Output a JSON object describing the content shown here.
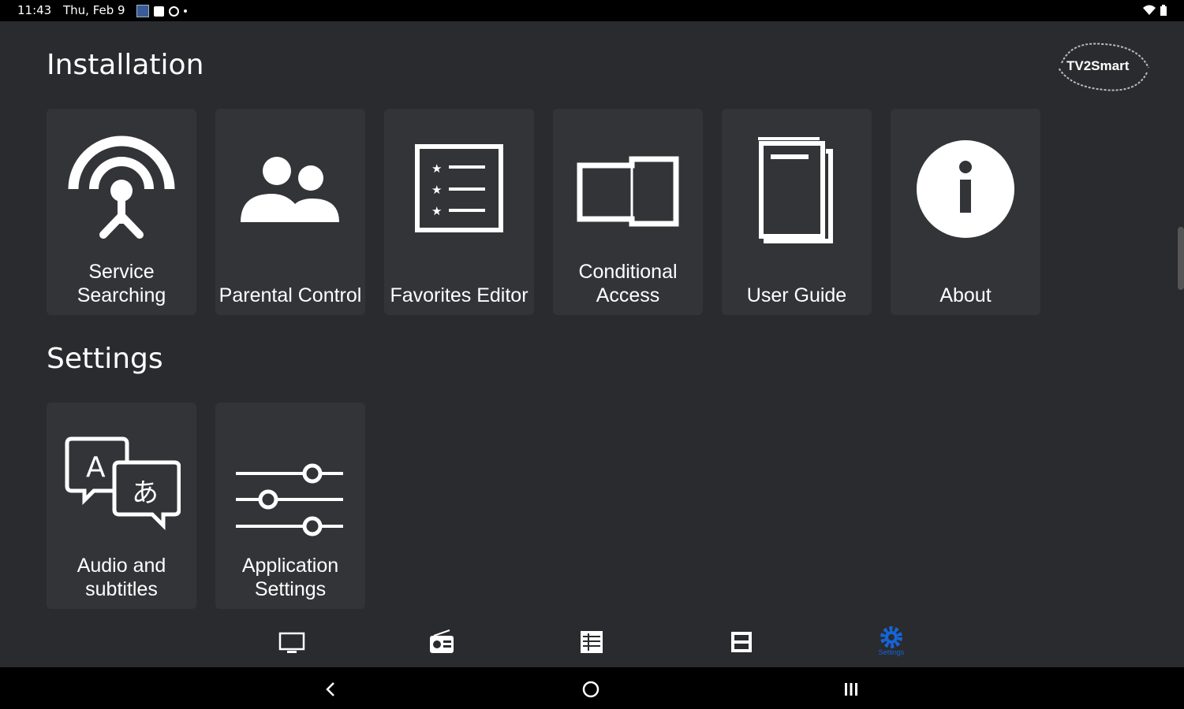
{
  "status_bar": {
    "time": "11:43",
    "date": "Thu, Feb 9"
  },
  "logo": {
    "text": "TV2Smart"
  },
  "installation": {
    "title": "Installation",
    "tiles": [
      {
        "label": "Service Searching",
        "icon": "antenna-icon"
      },
      {
        "label": "Parental Control",
        "icon": "people-icon"
      },
      {
        "label": "Favorites Editor",
        "icon": "list-icon"
      },
      {
        "label": "Conditional Access",
        "icon": "card-slot-icon"
      },
      {
        "label": "User Guide",
        "icon": "document-icon"
      },
      {
        "label": "About",
        "icon": "info-icon"
      }
    ]
  },
  "settings": {
    "title": "Settings",
    "tiles": [
      {
        "label": "Audio and subtitles",
        "icon": "language-icon"
      },
      {
        "label": "Application Settings",
        "icon": "sliders-icon"
      }
    ]
  },
  "bottom_nav": {
    "items": [
      {
        "icon": "tv-icon"
      },
      {
        "icon": "radio-icon"
      },
      {
        "icon": "epg-icon"
      },
      {
        "icon": "recordings-icon"
      },
      {
        "icon": "settings-icon",
        "label": "Settings",
        "active": true
      }
    ],
    "active_color": "#1565d8"
  },
  "colors": {
    "background": "#2a2b2e",
    "tile": "#333438",
    "accent": "#1565d8"
  }
}
